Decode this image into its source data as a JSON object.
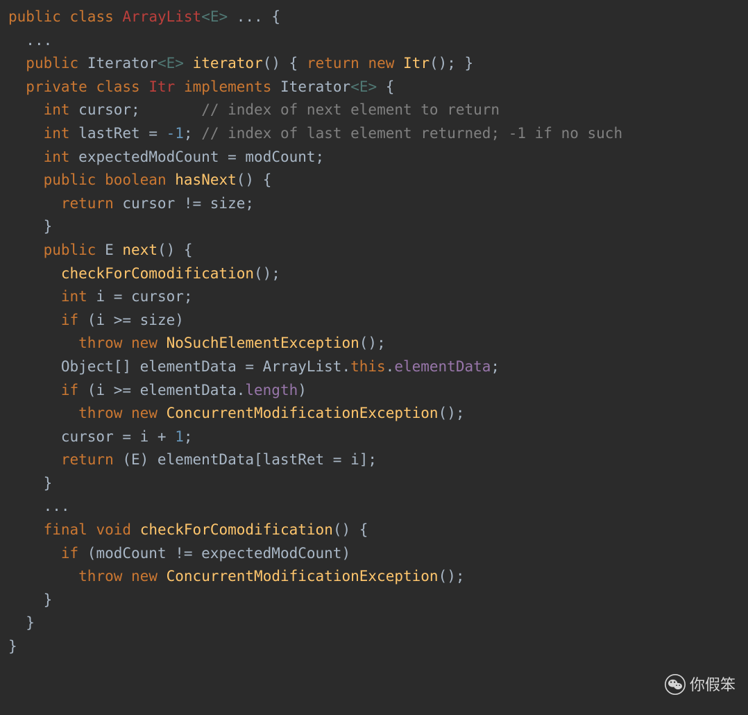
{
  "code": {
    "l1": {
      "kw1": "public",
      "kw2": "class",
      "cls": "ArrayList",
      "gen": "<E>",
      "rest": " ... {"
    },
    "l2": {
      "dots": "..."
    },
    "l3": {
      "kw1": "public",
      "type": "Iterator",
      "gen": "<E>",
      "meth": "iterator",
      "paren": "() { ",
      "kw2": "return",
      "kw3": "new",
      "ctor": "Itr",
      "end": "(); }"
    },
    "l4": {
      "kw1": "private",
      "kw2": "class",
      "cls": "Itr",
      "kw3": "implements",
      "iface": "Iterator",
      "gen": "<E>",
      "brace": " {"
    },
    "l5": {
      "kw": "int",
      "var": "cursor;",
      "cmt": "// index of next element to return"
    },
    "l6": {
      "kw": "int",
      "var": "lastRet",
      "eq": " = ",
      "num": "-1",
      "semi": "; ",
      "cmt": "// index of last element returned; -1 if no such"
    },
    "l7": {
      "kw": "int",
      "var": "expectedModCount",
      "eq": " = ",
      "rhs": "modCount;"
    },
    "l8": {
      "kw1": "public",
      "kw2": "boolean",
      "meth": "hasNext",
      "paren": "() {"
    },
    "l9": {
      "kw": "return",
      "expr": " cursor != size;"
    },
    "l10": {
      "brace": "}"
    },
    "l11": {
      "kw1": "public",
      "type": "E",
      "meth": "next",
      "paren": "() {"
    },
    "l12": {
      "meth": "checkForComodification",
      "paren": "();"
    },
    "l13": {
      "kw": "int",
      "rest": " i = cursor;"
    },
    "l14": {
      "kw": "if",
      "rest": " (i >= size)"
    },
    "l15": {
      "kw1": "throw",
      "kw2": "new",
      "ctor": "NoSuchElementException",
      "paren": "();"
    },
    "l16": {
      "lhs": "Object[] elementData = ArrayList.",
      "kw": "this",
      "dot": ".",
      "fld": "elementData",
      "semi": ";"
    },
    "l17": {
      "kw": "if",
      "rest": " (i >= elementData.",
      "fld": "length",
      "paren": ")"
    },
    "l18": {
      "kw1": "throw",
      "kw2": "new",
      "ctor": "ConcurrentModificationException",
      "paren": "();"
    },
    "l19": {
      "lhs": "cursor = i + ",
      "num": "1",
      "semi": ";"
    },
    "l20": {
      "kw": "return",
      "rest": " (E) elementData[lastRet = i];"
    },
    "l21": {
      "brace": "}"
    },
    "l22": {
      "dots": "..."
    },
    "l23": {
      "kw1": "final",
      "kw2": "void",
      "meth": "checkForComodification",
      "paren": "() {"
    },
    "l24": {
      "kw": "if",
      "rest": " (modCount != expectedModCount)"
    },
    "l25": {
      "kw1": "throw",
      "kw2": "new",
      "ctor": "ConcurrentModificationException",
      "paren": "();"
    },
    "l26": {
      "brace": "}"
    },
    "l27": {
      "brace": "}"
    },
    "l28": {
      "brace": "}"
    }
  },
  "watermark": {
    "text": "你假笨"
  }
}
